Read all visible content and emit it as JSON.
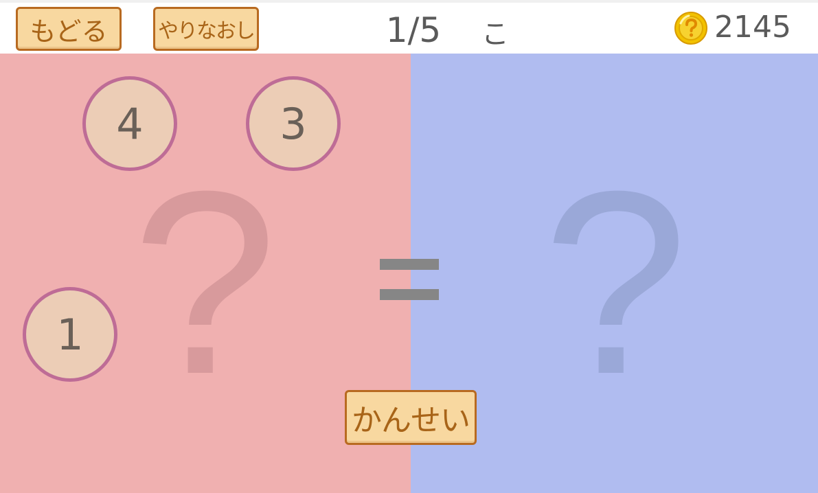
{
  "header": {
    "back_label": "もどる",
    "redo_label": "やりなおし",
    "progress": "1/5",
    "kana": "こ",
    "coin_count": "2145"
  },
  "equation": {
    "left_placeholder": "?",
    "operator": "=",
    "right_placeholder": "?"
  },
  "tiles": [
    {
      "value": "4"
    },
    {
      "value": "3"
    },
    {
      "value": "1"
    }
  ],
  "actions": {
    "done_label": "かんせい"
  },
  "colors": {
    "left_panel": "#f0b0b0",
    "right_panel": "#b0bcf0",
    "button_fill": "#f8d8a0",
    "button_border": "#b86a20",
    "tile_fill": "#eccdb6",
    "tile_border": "#be6c96",
    "coin": "#f2c200"
  }
}
